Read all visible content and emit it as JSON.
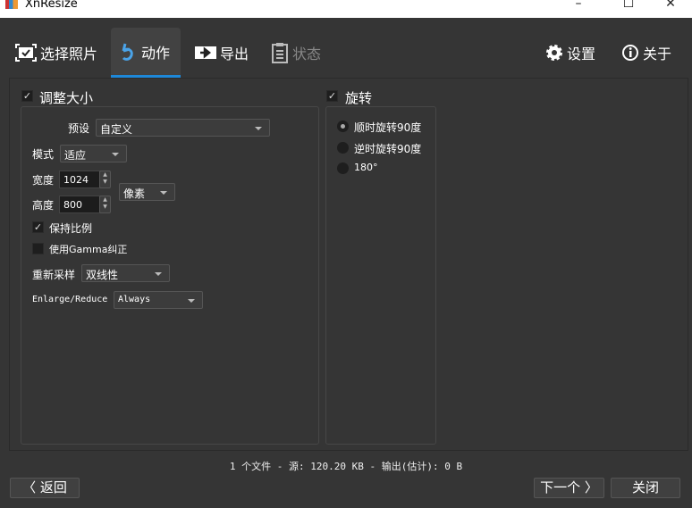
{
  "window": {
    "title": "XnResize",
    "minimize": "–",
    "maximize": "☐",
    "close": "✕"
  },
  "tabs": [
    {
      "label": "选择照片"
    },
    {
      "label": "动作"
    },
    {
      "label": "导出"
    },
    {
      "label": "状态"
    }
  ],
  "top_right": {
    "settings": "设置",
    "about": "关于"
  },
  "resize": {
    "title": "调整大小",
    "checked": true,
    "preset_label": "预设",
    "preset_value": "自定义",
    "mode_label": "模式",
    "mode_value": "适应",
    "width_label": "宽度",
    "width_value": "1024",
    "height_label": "高度",
    "height_value": "800",
    "unit_value": "像素",
    "keep_ratio": "保持比例",
    "gamma": "使用Gamma纠正",
    "resample_label": "重新采样",
    "resample_value": "双线性",
    "enlarge_label": "Enlarge/Reduce",
    "enlarge_value": "Always"
  },
  "rotate": {
    "title": "旋转",
    "checked": true,
    "options": [
      {
        "label": "顺时旋转90度",
        "selected": true
      },
      {
        "label": "逆时旋转90度",
        "selected": false
      },
      {
        "label": "180°",
        "selected": false
      }
    ]
  },
  "status": "1 个文件 - 源: 120.20 KB - 输出(估计): 0 B",
  "buttons": {
    "back": "〈 返回",
    "next": "下一个 〉",
    "close": "关闭"
  }
}
